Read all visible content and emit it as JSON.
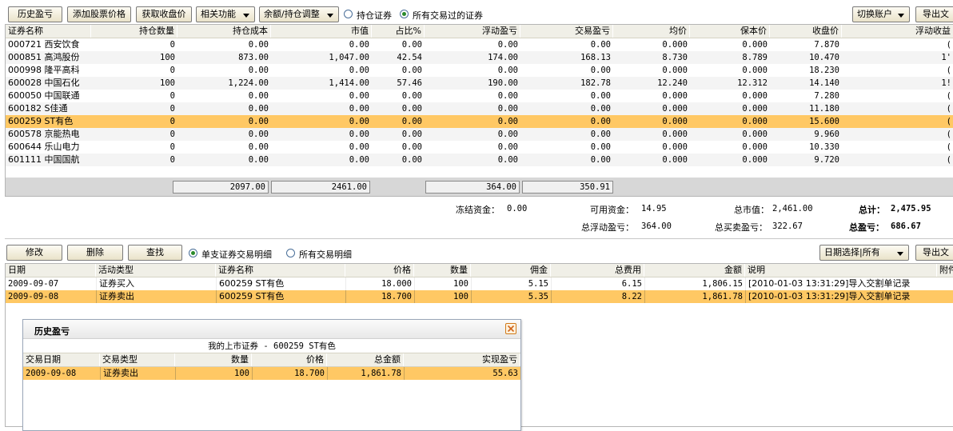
{
  "toolbar": {
    "history_pl": "历史盈亏",
    "add_price": "添加股票价格",
    "get_close": "获取收盘价",
    "related": "相关功能",
    "adjust": "余额/持仓调整",
    "opt_holding": "持仓证券",
    "opt_all_traded": "所有交易过的证券",
    "switch_account": "切换账户",
    "export": "导出文"
  },
  "holdings": {
    "headers": [
      "证券名称",
      "持仓数量",
      "持仓成本",
      "市值",
      "占比%",
      "浮动盈亏",
      "交易盈亏",
      "均价",
      "保本价",
      "收盘价",
      "浮动收益"
    ],
    "rows": [
      {
        "name": "000721  西安饮食",
        "qty": "0",
        "cost": "0.00",
        "mv": "0.00",
        "pct": "0.00",
        "fpl": "0.00",
        "tpl": "0.00",
        "avg": "0.000",
        "be": "0.000",
        "close": "7.870",
        "fret": "("
      },
      {
        "name": "000851  高鸿股份",
        "qty": "100",
        "cost": "873.00",
        "mv": "1,047.00",
        "pct": "42.54",
        "fpl": "174.00",
        "tpl": "168.13",
        "avg": "8.730",
        "be": "8.789",
        "close": "10.470",
        "fret": "1'"
      },
      {
        "name": "000998  隆平高科",
        "qty": "0",
        "cost": "0.00",
        "mv": "0.00",
        "pct": "0.00",
        "fpl": "0.00",
        "tpl": "0.00",
        "avg": "0.000",
        "be": "0.000",
        "close": "18.230",
        "fret": "("
      },
      {
        "name": "600028  中国石化",
        "qty": "100",
        "cost": "1,224.00",
        "mv": "1,414.00",
        "pct": "57.46",
        "fpl": "190.00",
        "tpl": "182.78",
        "avg": "12.240",
        "be": "12.312",
        "close": "14.140",
        "fret": "1!"
      },
      {
        "name": "600050  中国联通",
        "qty": "0",
        "cost": "0.00",
        "mv": "0.00",
        "pct": "0.00",
        "fpl": "0.00",
        "tpl": "0.00",
        "avg": "0.000",
        "be": "0.000",
        "close": "7.280",
        "fret": "("
      },
      {
        "name": "600182  S佳通",
        "qty": "0",
        "cost": "0.00",
        "mv": "0.00",
        "pct": "0.00",
        "fpl": "0.00",
        "tpl": "0.00",
        "avg": "0.000",
        "be": "0.000",
        "close": "11.180",
        "fret": "("
      },
      {
        "name": "600259  ST有色",
        "qty": "0",
        "cost": "0.00",
        "mv": "0.00",
        "pct": "0.00",
        "fpl": "0.00",
        "tpl": "0.00",
        "avg": "0.000",
        "be": "0.000",
        "close": "15.600",
        "fret": "("
      },
      {
        "name": "600578  京能热电",
        "qty": "0",
        "cost": "0.00",
        "mv": "0.00",
        "pct": "0.00",
        "fpl": "0.00",
        "tpl": "0.00",
        "avg": "0.000",
        "be": "0.000",
        "close": "9.960",
        "fret": "("
      },
      {
        "name": "600644  乐山电力",
        "qty": "0",
        "cost": "0.00",
        "mv": "0.00",
        "pct": "0.00",
        "fpl": "0.00",
        "tpl": "0.00",
        "avg": "0.000",
        "be": "0.000",
        "close": "10.330",
        "fret": "("
      },
      {
        "name": "601111  中国国航",
        "qty": "0",
        "cost": "0.00",
        "mv": "0.00",
        "pct": "0.00",
        "fpl": "0.00",
        "tpl": "0.00",
        "avg": "0.000",
        "be": "0.000",
        "close": "9.720",
        "fret": "("
      }
    ],
    "selected_index": 6,
    "totals": {
      "cost": "2097.00",
      "mv": "2461.00",
      "fpl": "364.00",
      "tpl": "350.91"
    }
  },
  "summary": {
    "frozen_label": "冻结资金：",
    "frozen": "0.00",
    "avail_label": "可用资金：",
    "avail": "14.95",
    "total_mv_label": "总市值：",
    "total_mv": "2,461.00",
    "total_label": "总计：",
    "total": "2,475.95",
    "float_pl_label": "总浮动盈亏：",
    "float_pl": "364.00",
    "trade_pl_label": "总买卖盈亏：",
    "trade_pl": "322.67",
    "total_pl_label": "总盈亏：",
    "total_pl": "686.67"
  },
  "tx_toolbar": {
    "edit": "修改",
    "delete": "删除",
    "find": "查找",
    "opt_single": "单支证券交易明细",
    "opt_all": "所有交易明细",
    "date_select": "日期选择|所有",
    "export": "导出文"
  },
  "transactions": {
    "headers": [
      "日期",
      "活动类型",
      "证券名称",
      "价格",
      "数量",
      "佣金",
      "总费用",
      "金额",
      "说明",
      "附件"
    ],
    "rows": [
      {
        "date": "2009-09-07",
        "type": "证券买入",
        "sec": "600259  ST有色",
        "price": "18.000",
        "qty": "100",
        "comm": "5.15",
        "fee": "6.15",
        "amt": "1,806.15",
        "note": "[2010-01-03 13:31:29]导入交割单记录"
      },
      {
        "date": "2009-09-08",
        "type": "证券卖出",
        "sec": "600259  ST有色",
        "price": "18.700",
        "qty": "100",
        "comm": "5.35",
        "fee": "8.22",
        "amt": "1,861.78",
        "note": "[2010-01-03 13:31:29]导入交割单记录"
      }
    ],
    "selected_index": 1
  },
  "dialog": {
    "title": "历史盈亏",
    "caption": "我的上市证券 - 600259 ST有色",
    "headers": [
      "交易日期",
      "交易类型",
      "数量",
      "价格",
      "总金额",
      "实现盈亏"
    ],
    "rows": [
      {
        "date": "2009-09-08",
        "type": "证券卖出",
        "qty": "100",
        "price": "18.700",
        "total": "1,861.78",
        "pl": "55.63"
      }
    ]
  }
}
